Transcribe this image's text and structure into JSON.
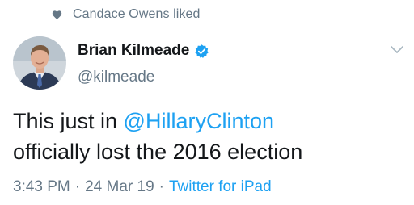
{
  "social_context": {
    "icon": "heart-icon",
    "text": "Candace Owens liked"
  },
  "author": {
    "name": "Brian Kilmeade",
    "handle": "@kilmeade",
    "verified": true,
    "avatar": "avatar"
  },
  "tweet": {
    "text_before": "This just in ",
    "mention": "@HillaryClinton",
    "text_after": "officially lost the 2016 election"
  },
  "meta": {
    "time": "3:43 PM",
    "separator": "·",
    "date": "24 Mar 19",
    "source": "Twitter for iPad"
  },
  "colors": {
    "accent": "#1da1f2",
    "secondary_text": "#657786",
    "primary_text": "#14171a"
  }
}
